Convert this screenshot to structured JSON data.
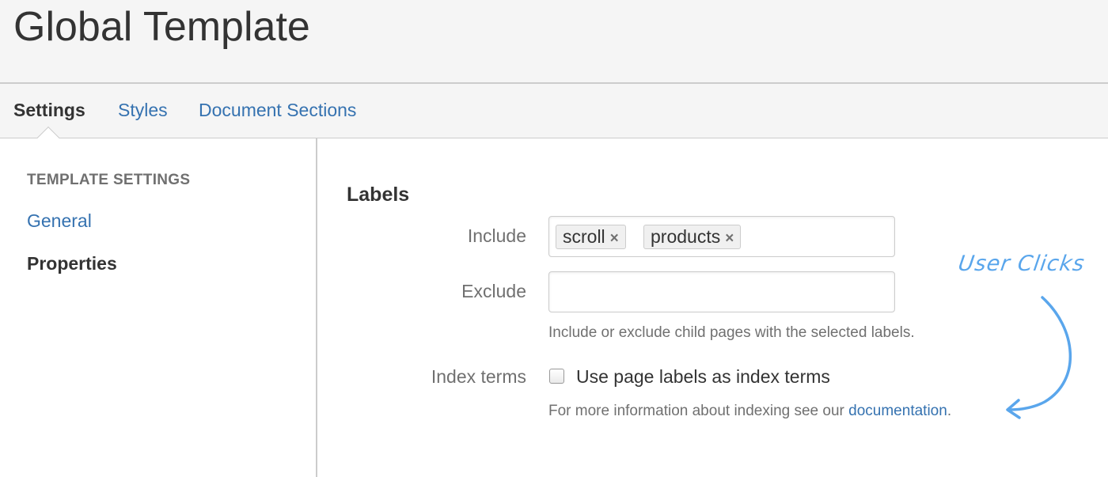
{
  "header": {
    "title": "Global Template"
  },
  "tabs": [
    {
      "label": "Settings",
      "active": true
    },
    {
      "label": "Styles",
      "active": false
    },
    {
      "label": "Document Sections",
      "active": false
    }
  ],
  "sidebar": {
    "heading": "TEMPLATE SETTINGS",
    "items": [
      {
        "label": "General",
        "active": false
      },
      {
        "label": "Properties",
        "active": true
      }
    ]
  },
  "labels_section": {
    "title": "Labels",
    "include": {
      "label": "Include",
      "tags": [
        {
          "text": "scroll",
          "remove_icon": "×"
        },
        {
          "text": "products",
          "remove_icon": "×"
        }
      ]
    },
    "exclude": {
      "label": "Exclude",
      "value": ""
    },
    "labels_help": "Include or exclude child pages with the selected labels.",
    "index_terms": {
      "label": "Index terms",
      "checkbox_label": "Use page labels as index terms",
      "checked": false
    },
    "index_help": {
      "prefix": "For more information about indexing see our ",
      "link": "documentation",
      "suffix": "."
    }
  },
  "annotation": {
    "text": "User Clicks",
    "color": "#5aa6ec"
  },
  "colors": {
    "link": "#3572b0",
    "text": "#333333",
    "muted": "#707070",
    "border": "#cccccc",
    "header_bg": "#f5f5f5"
  }
}
